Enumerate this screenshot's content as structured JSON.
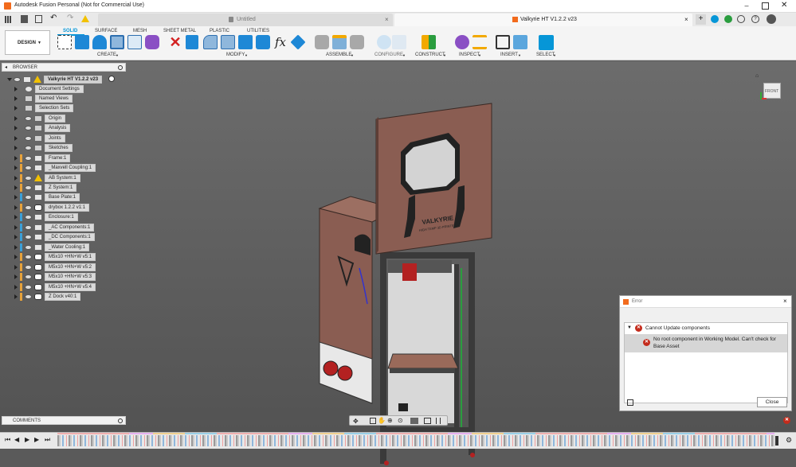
{
  "app": {
    "title": "Autodesk Fusion Personal (Not for Commercial Use)"
  },
  "tabs": [
    {
      "label": "Untitled"
    },
    {
      "label": "Valkyrie HT V1.2.2 v23"
    }
  ],
  "workspace": {
    "label": "DESIGN"
  },
  "toolbar": {
    "tabs": [
      "SOLID",
      "SURFACE",
      "MESH",
      "SHEET METAL",
      "PLASTIC",
      "UTILITIES"
    ],
    "groups": [
      "CREATE",
      "MODIFY",
      "ASSEMBLE",
      "CONFIGURE",
      "CONSTRUCT",
      "INSPECT",
      "INSERT",
      "SELECT"
    ]
  },
  "browser": {
    "header": "BROWSER",
    "root": "Valkyrie HT V1.2.2 v23",
    "items": [
      {
        "label": "Document Settings"
      },
      {
        "label": "Named Views"
      },
      {
        "label": "Selection Sets"
      },
      {
        "label": "Origin"
      },
      {
        "label": "Analysis"
      },
      {
        "label": "Joints"
      },
      {
        "label": "Sketches"
      },
      {
        "label": "Frame:1"
      },
      {
        "label": "_Maxvell Coupling:1"
      },
      {
        "label": "AB System:1"
      },
      {
        "label": "Z System:1"
      },
      {
        "label": "Base Plate:1"
      },
      {
        "label": "drybox 1.2.2 v1:1"
      },
      {
        "label": "Enclosure:1"
      },
      {
        "label": "_AC Components:1"
      },
      {
        "label": "_DC Components:1"
      },
      {
        "label": "_Water Cooling:1"
      },
      {
        "label": "M5x10 +HN+W v5:1"
      },
      {
        "label": "M5x10 +HN+W v5:2"
      },
      {
        "label": "M5x10 +HN+W v5:3"
      },
      {
        "label": "M5x10 +HN+W v5:4"
      },
      {
        "label": "Z Dock v40:1"
      }
    ]
  },
  "comments": {
    "label": "COMMENTS"
  },
  "viewcube": {
    "face": "FRONT"
  },
  "model": {
    "plate_text": "VALKYRIE",
    "plate_sub": "HIGH TEMP 3D PRINTER"
  },
  "dialog": {
    "title": "Error",
    "group": "Cannot Update components",
    "message": "No root component in Working Model. Can't check for Base Asset",
    "close": "Close"
  },
  "colors": {
    "accent": "#0696d7",
    "error": "#c42b1c",
    "panel_wood": "#8a5a4e"
  }
}
